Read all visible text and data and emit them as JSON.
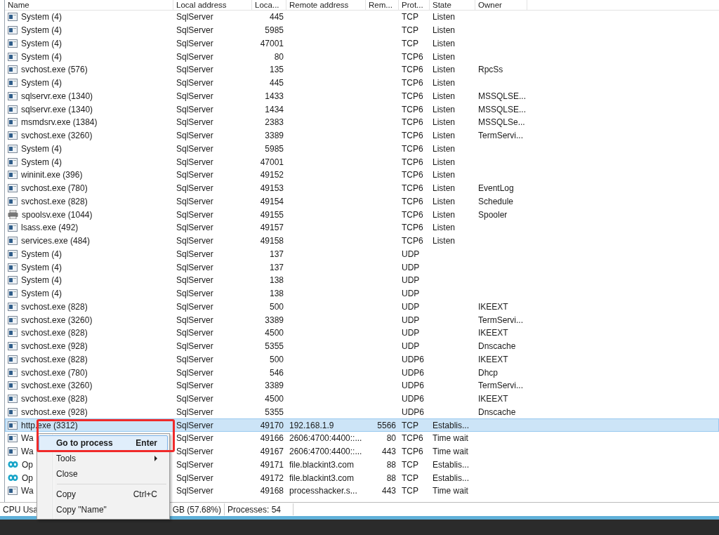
{
  "table": {
    "columns": [
      "Name",
      "Local address",
      "Loca...",
      "Remote address",
      "Rem...",
      "Prot...",
      "State",
      "Owner"
    ],
    "rows": [
      {
        "kind": "window",
        "name": "System (4)",
        "local": "SqlServer",
        "lport": "445",
        "proto": "TCP",
        "state": "Listen",
        "selected": false
      },
      {
        "kind": "window",
        "name": "System (4)",
        "local": "SqlServer",
        "lport": "5985",
        "proto": "TCP",
        "state": "Listen",
        "selected": false
      },
      {
        "kind": "window",
        "name": "System (4)",
        "local": "SqlServer",
        "lport": "47001",
        "proto": "TCP",
        "state": "Listen",
        "selected": false
      },
      {
        "kind": "window",
        "name": "System (4)",
        "local": "SqlServer",
        "lport": "80",
        "proto": "TCP6",
        "state": "Listen",
        "selected": false
      },
      {
        "kind": "window",
        "name": "svchost.exe (576)",
        "local": "SqlServer",
        "lport": "135",
        "proto": "TCP6",
        "state": "Listen",
        "owner": "RpcSs",
        "selected": false
      },
      {
        "kind": "window",
        "name": "System (4)",
        "local": "SqlServer",
        "lport": "445",
        "proto": "TCP6",
        "state": "Listen",
        "selected": false
      },
      {
        "kind": "window",
        "name": "sqlservr.exe (1340)",
        "local": "SqlServer",
        "lport": "1433",
        "proto": "TCP6",
        "state": "Listen",
        "owner": "MSSQLSE...",
        "selected": false
      },
      {
        "kind": "window",
        "name": "sqlservr.exe (1340)",
        "local": "SqlServer",
        "lport": "1434",
        "proto": "TCP6",
        "state": "Listen",
        "owner": "MSSQLSE...",
        "selected": false
      },
      {
        "kind": "window",
        "name": "msmdsrv.exe (1384)",
        "local": "SqlServer",
        "lport": "2383",
        "proto": "TCP6",
        "state": "Listen",
        "owner": "MSSQLSe...",
        "selected": false
      },
      {
        "kind": "window",
        "name": "svchost.exe (3260)",
        "local": "SqlServer",
        "lport": "3389",
        "proto": "TCP6",
        "state": "Listen",
        "owner": "TermServi...",
        "selected": false
      },
      {
        "kind": "window",
        "name": "System (4)",
        "local": "SqlServer",
        "lport": "5985",
        "proto": "TCP6",
        "state": "Listen",
        "selected": false
      },
      {
        "kind": "window",
        "name": "System (4)",
        "local": "SqlServer",
        "lport": "47001",
        "proto": "TCP6",
        "state": "Listen",
        "selected": false
      },
      {
        "kind": "window",
        "name": "wininit.exe (396)",
        "local": "SqlServer",
        "lport": "49152",
        "proto": "TCP6",
        "state": "Listen",
        "selected": false
      },
      {
        "kind": "window",
        "name": "svchost.exe (780)",
        "local": "SqlServer",
        "lport": "49153",
        "proto": "TCP6",
        "state": "Listen",
        "owner": "EventLog",
        "selected": false
      },
      {
        "kind": "window",
        "name": "svchost.exe (828)",
        "local": "SqlServer",
        "lport": "49154",
        "proto": "TCP6",
        "state": "Listen",
        "owner": "Schedule",
        "selected": false
      },
      {
        "kind": "printer",
        "name": "spoolsv.exe (1044)",
        "local": "SqlServer",
        "lport": "49155",
        "proto": "TCP6",
        "state": "Listen",
        "owner": "Spooler",
        "selected": false
      },
      {
        "kind": "window",
        "name": "lsass.exe (492)",
        "local": "SqlServer",
        "lport": "49157",
        "proto": "TCP6",
        "state": "Listen",
        "selected": false
      },
      {
        "kind": "window",
        "name": "services.exe (484)",
        "local": "SqlServer",
        "lport": "49158",
        "proto": "TCP6",
        "state": "Listen",
        "selected": false
      },
      {
        "kind": "window",
        "name": "System (4)",
        "local": "SqlServer",
        "lport": "137",
        "proto": "UDP",
        "selected": false
      },
      {
        "kind": "window",
        "name": "System (4)",
        "local": "SqlServer",
        "lport": "137",
        "proto": "UDP",
        "selected": false
      },
      {
        "kind": "window",
        "name": "System (4)",
        "local": "SqlServer",
        "lport": "138",
        "proto": "UDP",
        "selected": false
      },
      {
        "kind": "window",
        "name": "System (4)",
        "local": "SqlServer",
        "lport": "138",
        "proto": "UDP",
        "selected": false
      },
      {
        "kind": "window",
        "name": "svchost.exe (828)",
        "local": "SqlServer",
        "lport": "500",
        "proto": "UDP",
        "owner": "IKEEXT",
        "selected": false
      },
      {
        "kind": "window",
        "name": "svchost.exe (3260)",
        "local": "SqlServer",
        "lport": "3389",
        "proto": "UDP",
        "owner": "TermServi...",
        "selected": false
      },
      {
        "kind": "window",
        "name": "svchost.exe (828)",
        "local": "SqlServer",
        "lport": "4500",
        "proto": "UDP",
        "owner": "IKEEXT",
        "selected": false
      },
      {
        "kind": "window",
        "name": "svchost.exe (928)",
        "local": "SqlServer",
        "lport": "5355",
        "proto": "UDP",
        "owner": "Dnscache",
        "selected": false
      },
      {
        "kind": "window",
        "name": "svchost.exe (828)",
        "local": "SqlServer",
        "lport": "500",
        "proto": "UDP6",
        "owner": "IKEEXT",
        "selected": false
      },
      {
        "kind": "window",
        "name": "svchost.exe (780)",
        "local": "SqlServer",
        "lport": "546",
        "proto": "UDP6",
        "owner": "Dhcp",
        "selected": false
      },
      {
        "kind": "window",
        "name": "svchost.exe (3260)",
        "local": "SqlServer",
        "lport": "3389",
        "proto": "UDP6",
        "owner": "TermServi...",
        "selected": false
      },
      {
        "kind": "window",
        "name": "svchost.exe (828)",
        "local": "SqlServer",
        "lport": "4500",
        "proto": "UDP6",
        "owner": "IKEEXT",
        "selected": false
      },
      {
        "kind": "window",
        "name": "svchost.exe (928)",
        "local": "SqlServer",
        "lport": "5355",
        "proto": "UDP6",
        "owner": "Dnscache",
        "selected": false
      },
      {
        "kind": "window",
        "name": "http.exe (3312)",
        "local": "SqlServer",
        "lport": "49170",
        "remote": "192.168.1.9",
        "rport": "5566",
        "proto": "TCP",
        "state": "Establis...",
        "selected": true
      },
      {
        "kind": "window",
        "name": "Wa",
        "local": "SqlServer",
        "lport": "49166",
        "remote": "2606:4700:4400::...",
        "rport": "80",
        "proto": "TCP6",
        "state": "Time wait",
        "selected": false
      },
      {
        "kind": "window",
        "name": "Wa",
        "local": "SqlServer",
        "lport": "49167",
        "remote": "2606:4700:4400::...",
        "rport": "443",
        "proto": "TCP6",
        "state": "Time wait",
        "selected": false
      },
      {
        "kind": "link",
        "name": "Op",
        "local": "SqlServer",
        "lport": "49171",
        "remote": "file.blackint3.com",
        "rport": "88",
        "proto": "TCP",
        "state": "Establis...",
        "selected": false
      },
      {
        "kind": "link",
        "name": "Op",
        "local": "SqlServer",
        "lport": "49172",
        "remote": "file.blackint3.com",
        "rport": "88",
        "proto": "TCP",
        "state": "Establis...",
        "selected": false
      },
      {
        "kind": "window",
        "name": "Wa",
        "local": "SqlServer",
        "lport": "49168",
        "remote": "processhacker.s...",
        "rport": "443",
        "proto": "TCP",
        "state": "Time wait",
        "selected": false
      }
    ]
  },
  "context_menu": {
    "items": [
      {
        "kind": "item",
        "label": "Go to process",
        "shortcut": "Enter",
        "default": true,
        "selected": true,
        "submenu": false
      },
      {
        "kind": "item",
        "label": "Tools",
        "default": false,
        "selected": false,
        "submenu": true
      },
      {
        "kind": "item",
        "label": "Close",
        "default": false,
        "selected": false,
        "submenu": false
      },
      {
        "kind": "separator"
      },
      {
        "kind": "item",
        "label": "Copy",
        "shortcut": "Ctrl+C",
        "default": false,
        "selected": false,
        "submenu": false
      },
      {
        "kind": "item",
        "label": "Copy \"Name\"",
        "default": false,
        "selected": false,
        "submenu": false
      }
    ]
  },
  "status_bar": {
    "cpu": "CPU Usa",
    "memory": "GB (57.68%)",
    "processes": "Processes: 54"
  }
}
